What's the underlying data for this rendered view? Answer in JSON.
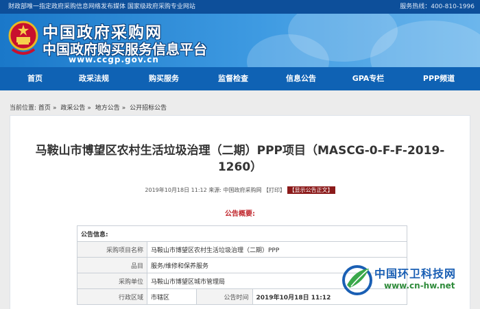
{
  "topbar": {
    "left_text": "财政部唯一指定政府采购信息网络发布媒体  国家级政府采购专业网站",
    "hotline": "服务热线：400-810-1996"
  },
  "header": {
    "site_name": "中国政府采购网",
    "site_subtitle": "中国政府购买服务信息平台",
    "site_url": "www.ccgp.gov.cn"
  },
  "nav": {
    "items": [
      {
        "label": "首页"
      },
      {
        "label": "政采法规"
      },
      {
        "label": "购买服务"
      },
      {
        "label": "监督检查"
      },
      {
        "label": "信息公告"
      },
      {
        "label": "GPA专栏"
      },
      {
        "label": "PPP频道"
      }
    ]
  },
  "breadcrumb": {
    "prefix": "当前位置:",
    "items": [
      "首页",
      "政采公告",
      "地方公告",
      "公开招标公告"
    ]
  },
  "notice": {
    "title": "马鞍山市博望区农村生活垃圾治理（二期）PPP项目（MASCG-0-F-F-2019-1260）",
    "meta": "2019年10月18日 11:12 来源: 中国政府采购网 ",
    "print_label": "【打印】",
    "show_label": "【显示公告正文】",
    "summary_label": "公告概要:"
  },
  "table": {
    "section_header": "公告信息:",
    "rows": [
      {
        "label": "采购项目名称",
        "value": "马鞍山市博望区农村生活垃圾治理（二期）PPP"
      },
      {
        "label": "品目",
        "value": "服务/维修和保养服务"
      },
      {
        "label": "采购单位",
        "value": "马鞍山市博望区城市管理局"
      }
    ],
    "last_row": {
      "label1": "行政区域",
      "value1": "市辖区",
      "label2": "公告时间",
      "value2": "2019年10月18日 11:12"
    }
  },
  "watermark": {
    "name": "中国环卫科技网",
    "url": "www.cn-hw.net"
  },
  "colors": {
    "topbar": "#0d4f9a",
    "nav": "#0f62b4",
    "summary": "#c0262c"
  }
}
